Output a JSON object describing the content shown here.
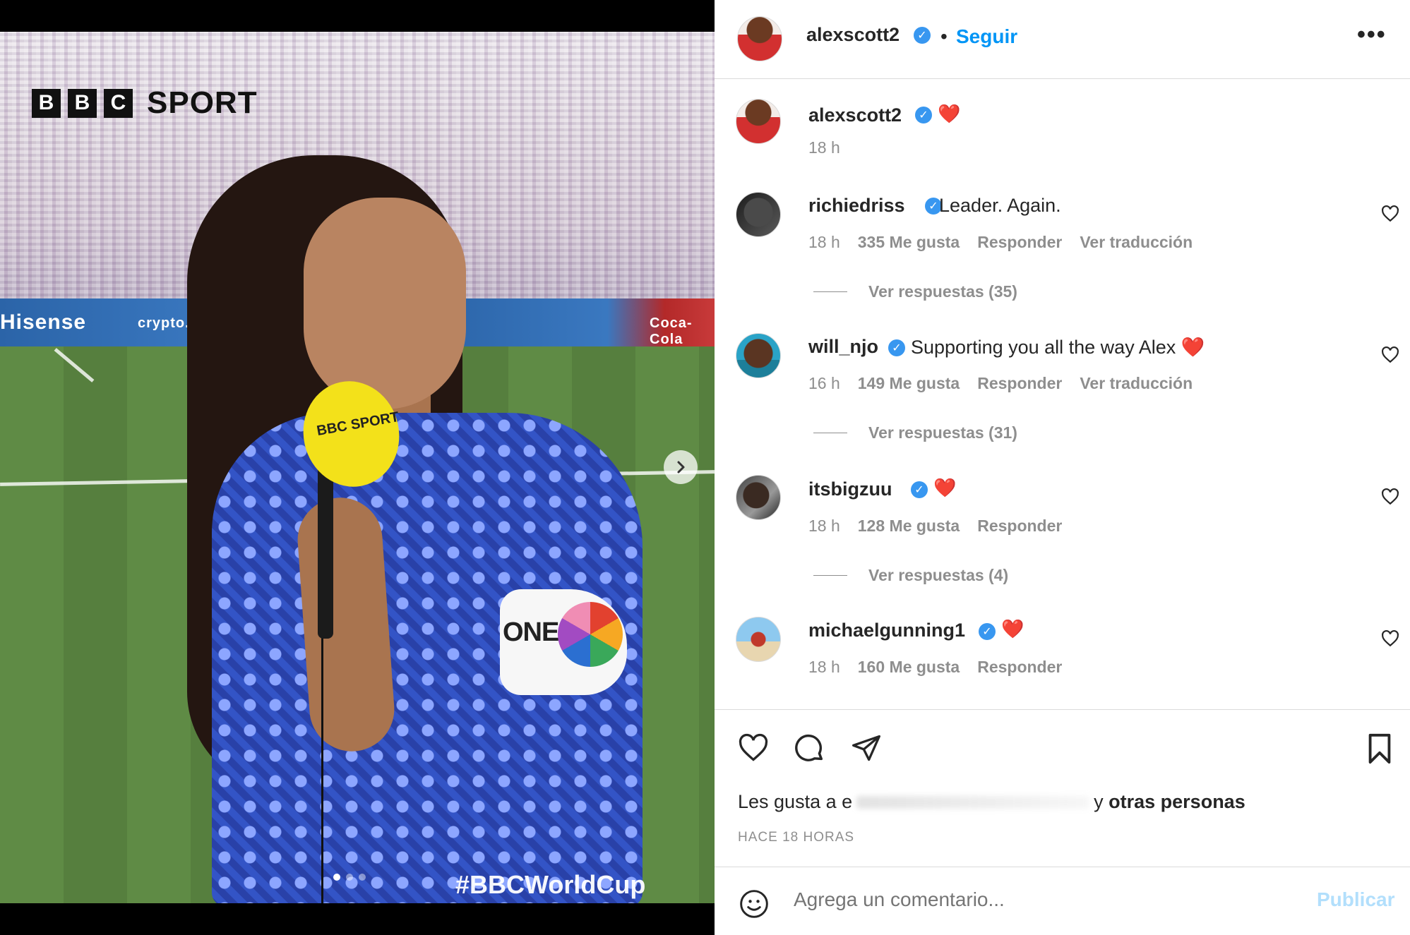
{
  "media": {
    "brand_letters": [
      "B",
      "B",
      "C"
    ],
    "brand_word": "SPORT",
    "hashtag": "#BBCWorldCup",
    "boards": [
      "Hisense",
      "crypto.com",
      "Coca-Cola"
    ],
    "mic_label": "BBC SPORT",
    "armband_text": "ONE",
    "carousel": {
      "total": 3,
      "active_index": 0
    },
    "next_icon": "chevron-right-icon"
  },
  "post": {
    "author": "alexscott2",
    "follow_label": "Seguir",
    "separator": "•",
    "more_label": "•••",
    "caption": {
      "username": "alexscott2",
      "text": "❤️",
      "time": "18 h"
    }
  },
  "comments": [
    {
      "username": "richiedriss",
      "text": "Leader. Again.",
      "time": "18 h",
      "likes": "335 Me gusta",
      "reply": "Responder",
      "translate": "Ver traducción",
      "replies": "Ver respuestas (35)"
    },
    {
      "username": "will_njo",
      "text": "Supporting you all the way Alex ❤️",
      "time": "16 h",
      "likes": "149 Me gusta",
      "reply": "Responder",
      "translate": "Ver traducción",
      "replies": "Ver respuestas (31)"
    },
    {
      "username": "itsbigzuu",
      "text": "❤️",
      "time": "18 h",
      "likes": "128 Me gusta",
      "reply": "Responder",
      "translate": "",
      "replies": "Ver respuestas (4)"
    },
    {
      "username": "michaelgunning1",
      "text": "❤️",
      "time": "18 h",
      "likes": "160 Me gusta",
      "reply": "Responder",
      "translate": "",
      "replies": ""
    }
  ],
  "actions": {
    "icons": [
      "heart-icon",
      "comment-icon",
      "share-icon",
      "bookmark-icon"
    ],
    "likes_prefix": "Les gusta a e",
    "likes_middle": "y",
    "likes_suffix": "otras personas",
    "time_ago": "HACE 18 HORAS"
  },
  "comment_box": {
    "placeholder": "Agrega un comentario...",
    "publish_label": "Publicar",
    "emoji_icon": "emoji-icon"
  },
  "colors": {
    "accent": "#0095f6",
    "verified": "#3897f0",
    "muted": "#8e8e8e",
    "heart": "#e0245e"
  }
}
